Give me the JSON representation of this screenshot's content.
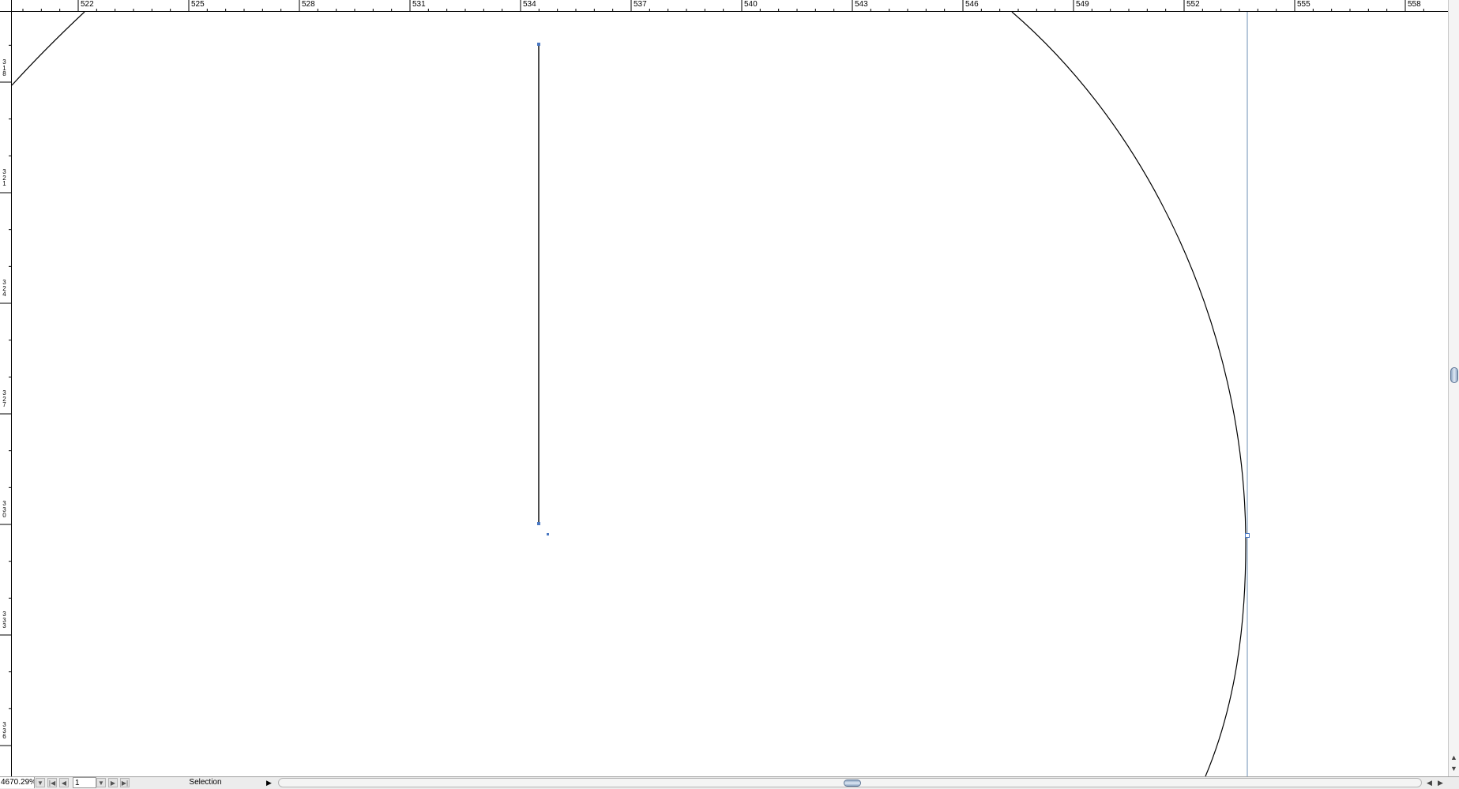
{
  "ruler": {
    "horizontal_labels": [
      "522",
      "525",
      "528",
      "531",
      "534",
      "537",
      "540",
      "543",
      "546",
      "549",
      "552",
      "555",
      "558"
    ],
    "vertical_labels": [
      "3\n1\n8",
      "3\n2\n1",
      "3\n2\n4",
      "3\n2\n7",
      "3\n3\n0",
      "3\n3\n3",
      "3\n3\n6"
    ]
  },
  "status_bar": {
    "zoom": "4670.29%",
    "page": "1",
    "tool": "Selection"
  },
  "icons": {
    "zoom_menu": "chevron-down-icon",
    "first_page": "first-page-icon",
    "prev_page": "previous-page-icon",
    "page_menu": "chevron-down-icon",
    "next_page": "next-page-icon",
    "last_page": "last-page-icon",
    "status_menu": "play-icon",
    "scroll_up": "arrow-up-icon",
    "scroll_down": "arrow-down-icon",
    "scroll_left": "arrow-left-icon",
    "scroll_right": "arrow-right-icon"
  },
  "colors": {
    "selection": "#4a78c2",
    "guide": "#6d8fb5",
    "path": "#000000"
  }
}
